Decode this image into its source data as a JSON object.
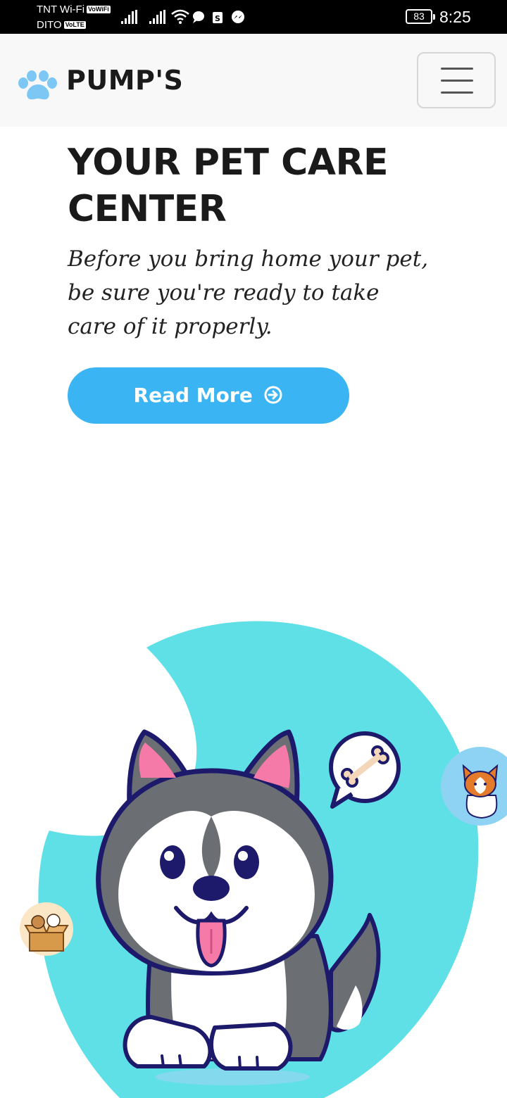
{
  "status_bar": {
    "carrier1": "TNT Wi-Fi",
    "carrier1_tag": "VoWiFi",
    "carrier2": "DITO",
    "carrier2_tag": "VoLTE",
    "battery": "83",
    "time": "8:25",
    "icons": [
      "signal-icon",
      "signal-icon",
      "wifi-icon",
      "chat-icon",
      "shop-icon",
      "messenger-icon"
    ]
  },
  "navbar": {
    "brand": "PUMP'S",
    "logo_icon": "paw-icon",
    "menu_icon": "hamburger-icon"
  },
  "hero": {
    "title": "YOUR PET CARE CENTER",
    "subtitle": "Before you bring home your pet, be sure you're ready to take care of it properly.",
    "button_label": "Read More",
    "button_icon": "arrow-circle-right-icon"
  },
  "colors": {
    "accent": "#3ab4f2",
    "paw": "#7cc7f4",
    "blob": "#5fdfe6",
    "brand_text": "#1a1a1a"
  }
}
